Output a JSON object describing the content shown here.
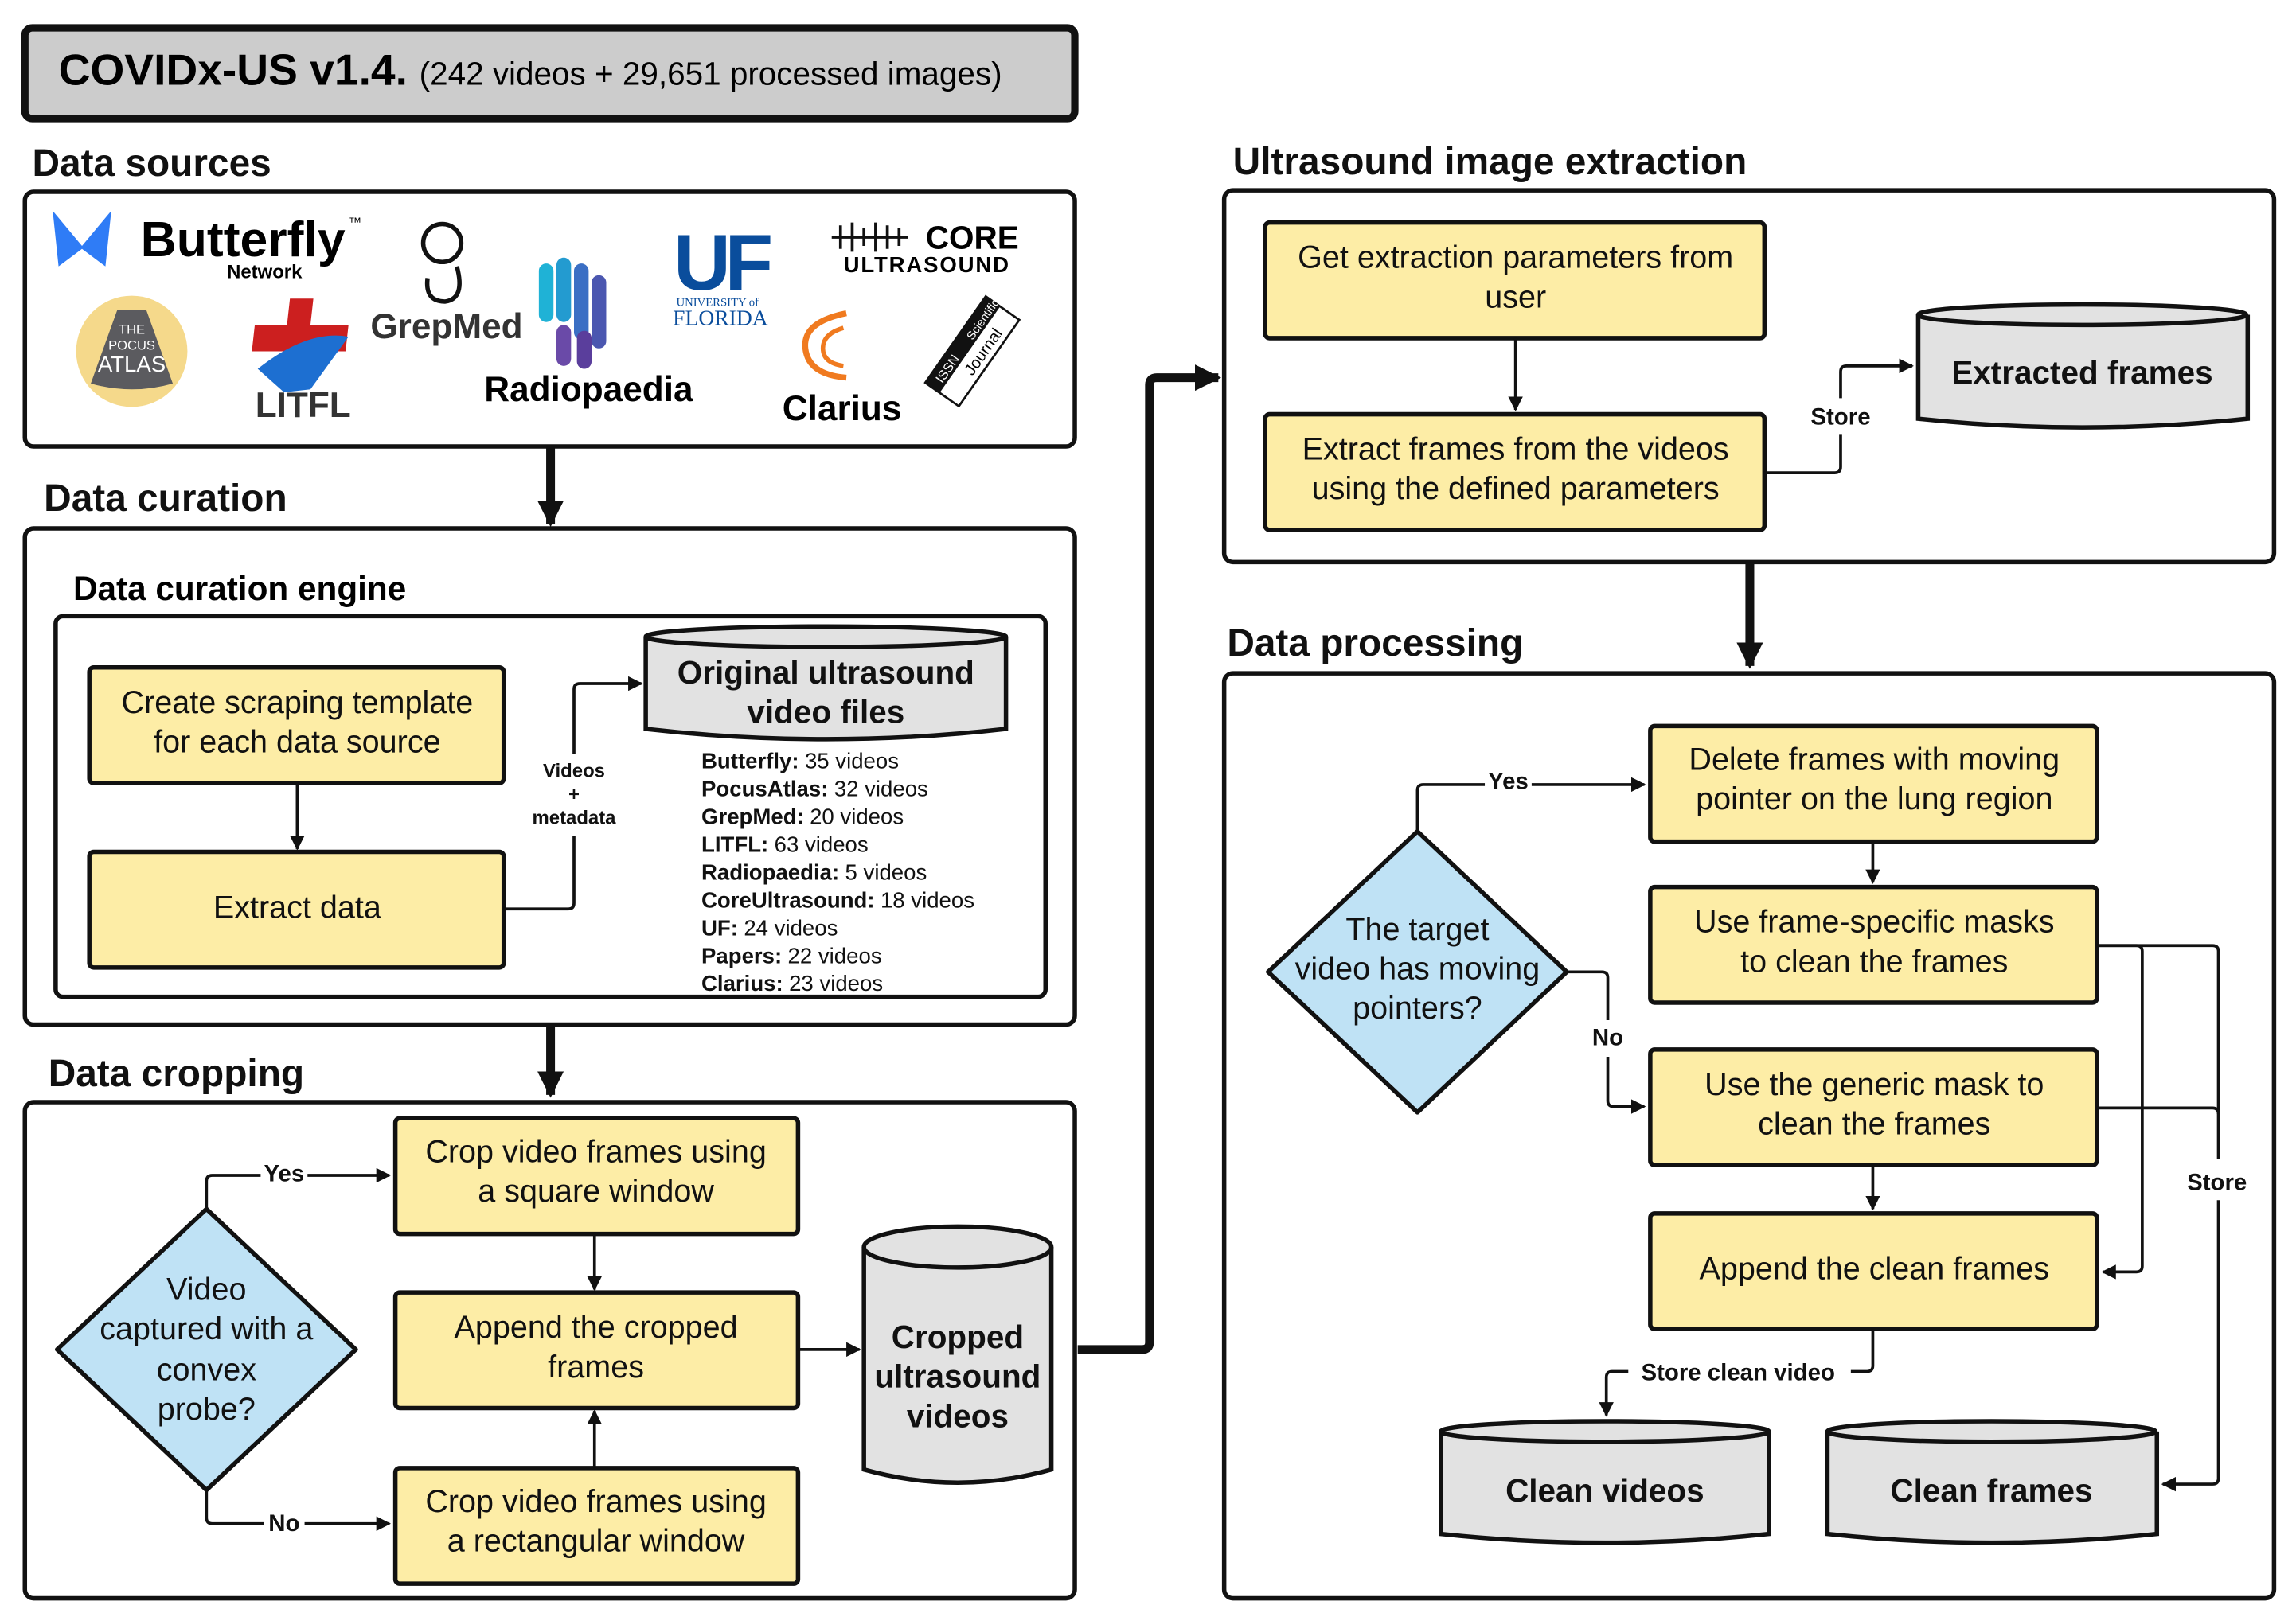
{
  "title": {
    "main": "COVIDx-US v1.4.",
    "sub": "(242 videos + 29,651 processed images)"
  },
  "data_sources": {
    "label": "Data sources",
    "logos": {
      "butterfly": "Butterfly",
      "butterfly_sub": "Network",
      "butterfly_tm": "™",
      "pocus": [
        "THE",
        "POCUS",
        "ATLAS"
      ],
      "litfl": "LITFL",
      "grepmed": "GrepMed",
      "radiopaedia": "Radiopaedia",
      "uf": "UF",
      "uf_sub1": "UNIVERSITY of",
      "uf_sub2": "FLORIDA",
      "core": "CORE",
      "core_sub": "ULTRASOUND",
      "clarius": "Clarius",
      "journal": [
        "ISSN",
        "Scientific",
        "Journal"
      ]
    }
  },
  "data_curation": {
    "label": "Data curation",
    "engine_label": "Data curation engine",
    "create_template": [
      "Create scraping template",
      "for each data source"
    ],
    "extract_data": "Extract data",
    "edge_label": [
      "Videos",
      "+",
      "metadata"
    ],
    "original_store": [
      "Original ultrasound",
      "video files"
    ],
    "counts": [
      {
        "source": "Butterfly:",
        "count": "35 videos"
      },
      {
        "source": "PocusAtlas:",
        "count": "32 videos"
      },
      {
        "source": "GrepMed:",
        "count": "20 videos"
      },
      {
        "source": "LITFL:",
        "count": "63 videos"
      },
      {
        "source": "Radiopaedia:",
        "count": "5 videos"
      },
      {
        "source": "CoreUltrasound:",
        "count": "18 videos"
      },
      {
        "source": "UF:",
        "count": "24 videos"
      },
      {
        "source": "Papers:",
        "count": "22 videos"
      },
      {
        "source": "Clarius:",
        "count": "23 videos"
      }
    ]
  },
  "data_cropping": {
    "label": "Data cropping",
    "decision": [
      "Video",
      "captured with a",
      "convex",
      "probe?"
    ],
    "yes": "Yes",
    "no": "No",
    "square": [
      "Crop video frames using",
      "a square window"
    ],
    "append": [
      "Append the cropped",
      "frames"
    ],
    "rect": [
      "Crop video frames using",
      "a rectangular window"
    ],
    "store": [
      "Cropped",
      "ultrasound",
      "videos"
    ]
  },
  "extraction": {
    "label": "Ultrasound image extraction",
    "get_params": [
      "Get extraction parameters from",
      "user"
    ],
    "extract_frames": [
      "Extract frames from the videos",
      "using the defined parameters"
    ],
    "store_label": "Store",
    "store": "Extracted frames"
  },
  "processing": {
    "label": "Data processing",
    "decision": [
      "The target",
      "video has moving",
      "pointers?"
    ],
    "yes": "Yes",
    "no": "No",
    "delete": [
      "Delete frames with moving",
      "pointer on the lung region"
    ],
    "specific": [
      "Use frame-specific masks",
      "to clean the frames"
    ],
    "generic": [
      "Use the generic mask to",
      "clean the frames"
    ],
    "append": "Append the clean frames",
    "store_label": "Store",
    "store_clean_label": "Store clean video",
    "clean_videos": "Clean videos",
    "clean_frames": "Clean frames"
  },
  "colors": {
    "process": "#fdeda6",
    "decision": "#bfe2f5",
    "store": "#e2e2e2",
    "title_bg": "#cccccc"
  }
}
